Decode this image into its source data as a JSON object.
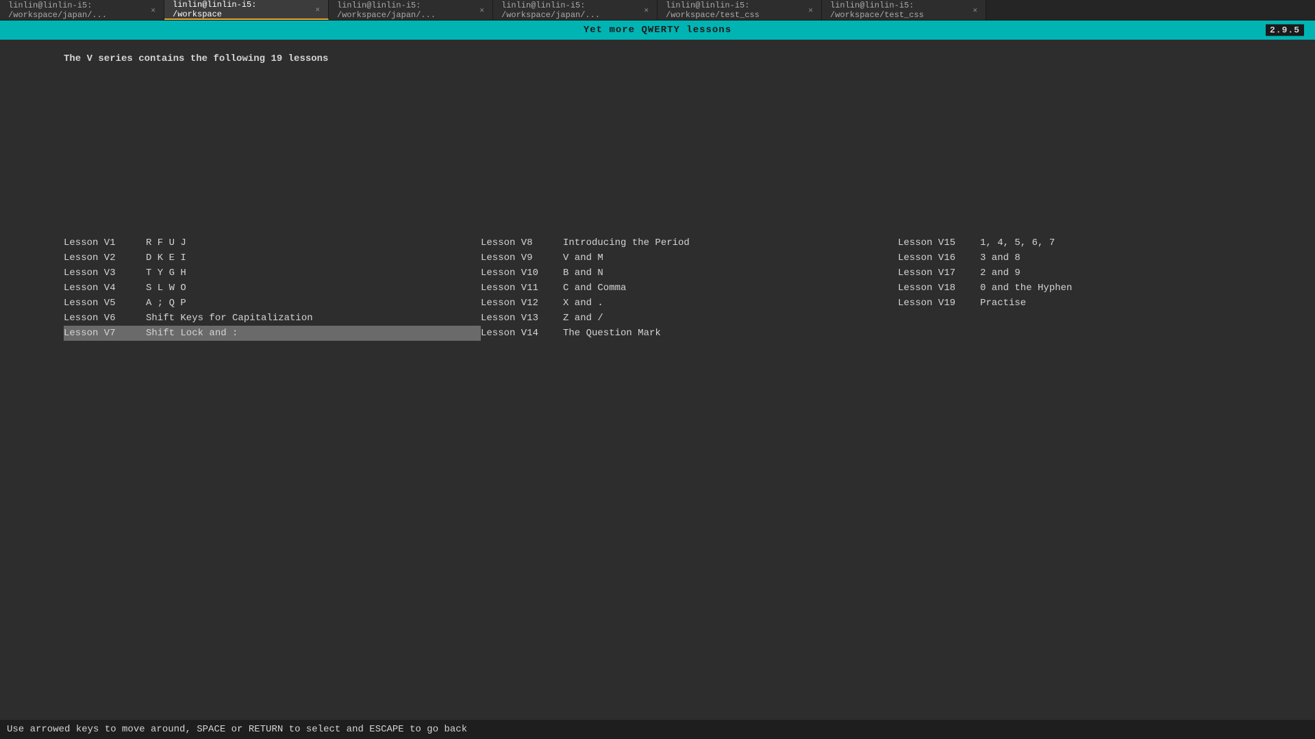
{
  "tabs": [
    {
      "id": "tab1",
      "label": "linlin@linlin-i5: /workspace/japan/...",
      "active": false
    },
    {
      "id": "tab2",
      "label": "linlin@linlin-i5: /workspace",
      "active": true
    },
    {
      "id": "tab3",
      "label": "linlin@linlin-i5: /workspace/japan/...",
      "active": false
    },
    {
      "id": "tab4",
      "label": "linlin@linlin-i5: /workspace/japan/...",
      "active": false
    },
    {
      "id": "tab5",
      "label": "linlin@linlin-i5: /workspace/test_css",
      "active": false
    },
    {
      "id": "tab6",
      "label": "linlin@linlin-i5: /workspace/test_css",
      "active": false
    }
  ],
  "titleBar": {
    "title": "Yet more QWERTY lessons",
    "version": "2.9.5"
  },
  "pageTitle": "The V series contains the following 19 lessons",
  "columns": [
    {
      "lessons": [
        {
          "id": "Lesson V1",
          "title": "R F U J",
          "selected": false
        },
        {
          "id": "Lesson V2",
          "title": "D K E I",
          "selected": false
        },
        {
          "id": "Lesson V3",
          "title": "T Y G H",
          "selected": false
        },
        {
          "id": "Lesson V4",
          "title": "S L W O",
          "selected": false
        },
        {
          "id": "Lesson V5",
          "title": "A ; Q P",
          "selected": false
        },
        {
          "id": "Lesson V6",
          "title": "Shift Keys for Capitalization",
          "selected": false
        },
        {
          "id": "Lesson V7",
          "title": "Shift Lock and :",
          "selected": true
        }
      ]
    },
    {
      "lessons": [
        {
          "id": "Lesson V8",
          "title": "Introducing the Period",
          "selected": false
        },
        {
          "id": "Lesson V9",
          "title": "V and M",
          "selected": false
        },
        {
          "id": "Lesson V10",
          "title": "B and N",
          "selected": false
        },
        {
          "id": "Lesson V11",
          "title": "C and Comma",
          "selected": false
        },
        {
          "id": "Lesson V12",
          "title": "X and .",
          "selected": false
        },
        {
          "id": "Lesson V13",
          "title": "Z and /",
          "selected": false
        },
        {
          "id": "Lesson V14",
          "title": "The Question Mark",
          "selected": false
        }
      ]
    },
    {
      "lessons": [
        {
          "id": "Lesson V15",
          "title": "1, 4, 5, 6, 7",
          "selected": false
        },
        {
          "id": "Lesson V16",
          "title": "3 and 8",
          "selected": false
        },
        {
          "id": "Lesson V17",
          "title": "2 and 9",
          "selected": false
        },
        {
          "id": "Lesson V18",
          "title": "0 and the Hyphen",
          "selected": false
        },
        {
          "id": "Lesson V19",
          "title": "Practise",
          "selected": false
        }
      ]
    }
  ],
  "statusBar": {
    "text": "Use arrowed keys to move around, SPACE or RETURN to select and ESCAPE to go back"
  }
}
